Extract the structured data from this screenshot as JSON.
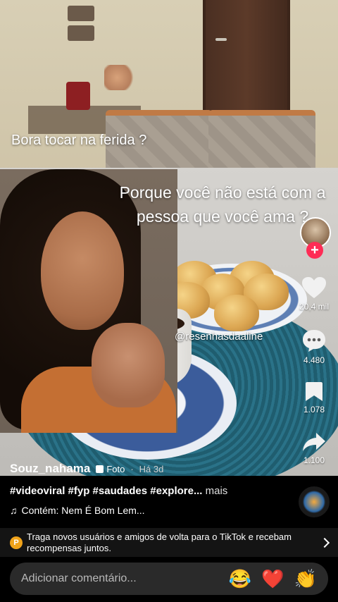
{
  "overlay": {
    "line1": "Bora tocar na ferida ?",
    "line2": "Porque você não está com a pessoa que você ama ?",
    "watermark": "@resenhasdaaline"
  },
  "actions": {
    "like_count": "20,4 mil",
    "comment_count": "4.480",
    "save_count": "1.078",
    "share_count": "1.100"
  },
  "author": {
    "username": "Souz_nahama",
    "post_type": "Foto",
    "separator": "·",
    "age": "Há 3d"
  },
  "caption": {
    "text": "#videoviral #fyp #saudades #explore...",
    "more": "mais"
  },
  "music": {
    "icon": "♫",
    "label": "Contém: Nem É Bom Lem..."
  },
  "promo": {
    "coin_label": "P",
    "text": "Traga novos usuários e amigos de volta para o TikTok e recebam recompensas juntos."
  },
  "comment": {
    "placeholder": "Adicionar comentário...",
    "emoji_1": "😂",
    "emoji_2": "❤️",
    "emoji_3": "👏"
  },
  "colors": {
    "follow": "#fe2c55",
    "coin": "#f0a31a"
  }
}
